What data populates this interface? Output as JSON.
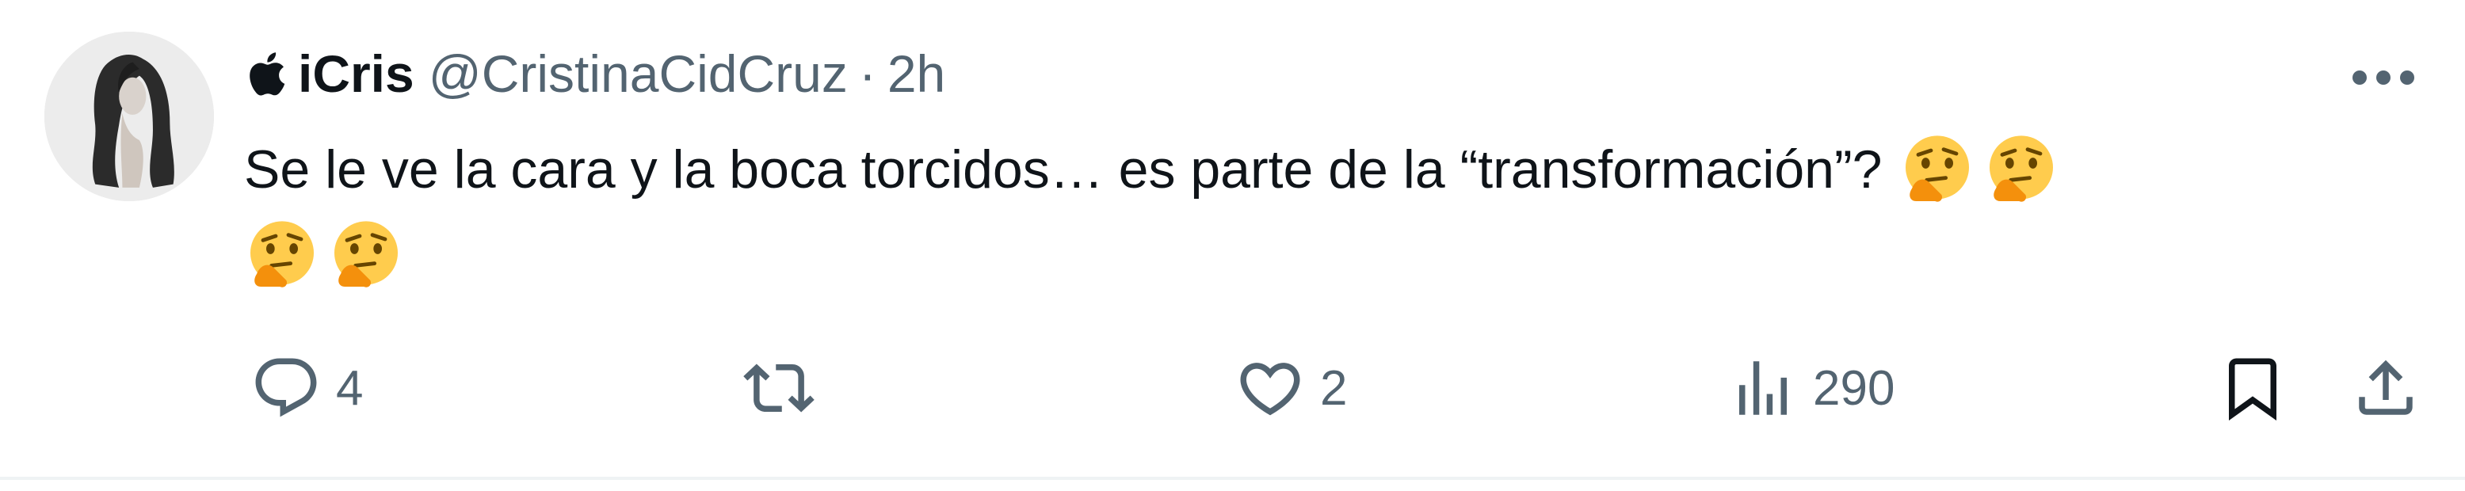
{
  "tweet": {
    "display_name": "iCris",
    "handle": "@CristinaCidCruz",
    "separator": "·",
    "time": "2h",
    "text_line1": "Se le ve la cara y la boca torcidos… es parte de la “transformación”?",
    "emoji_name": "thinking-face",
    "emoji_count_line1": 2,
    "emoji_count_line2": 2
  },
  "actions": {
    "replies": "4",
    "retweets": "",
    "likes": "2",
    "views": "290"
  },
  "colors": {
    "text_primary": "#0f1419",
    "text_secondary": "#536471",
    "divider": "#eff3f4"
  }
}
